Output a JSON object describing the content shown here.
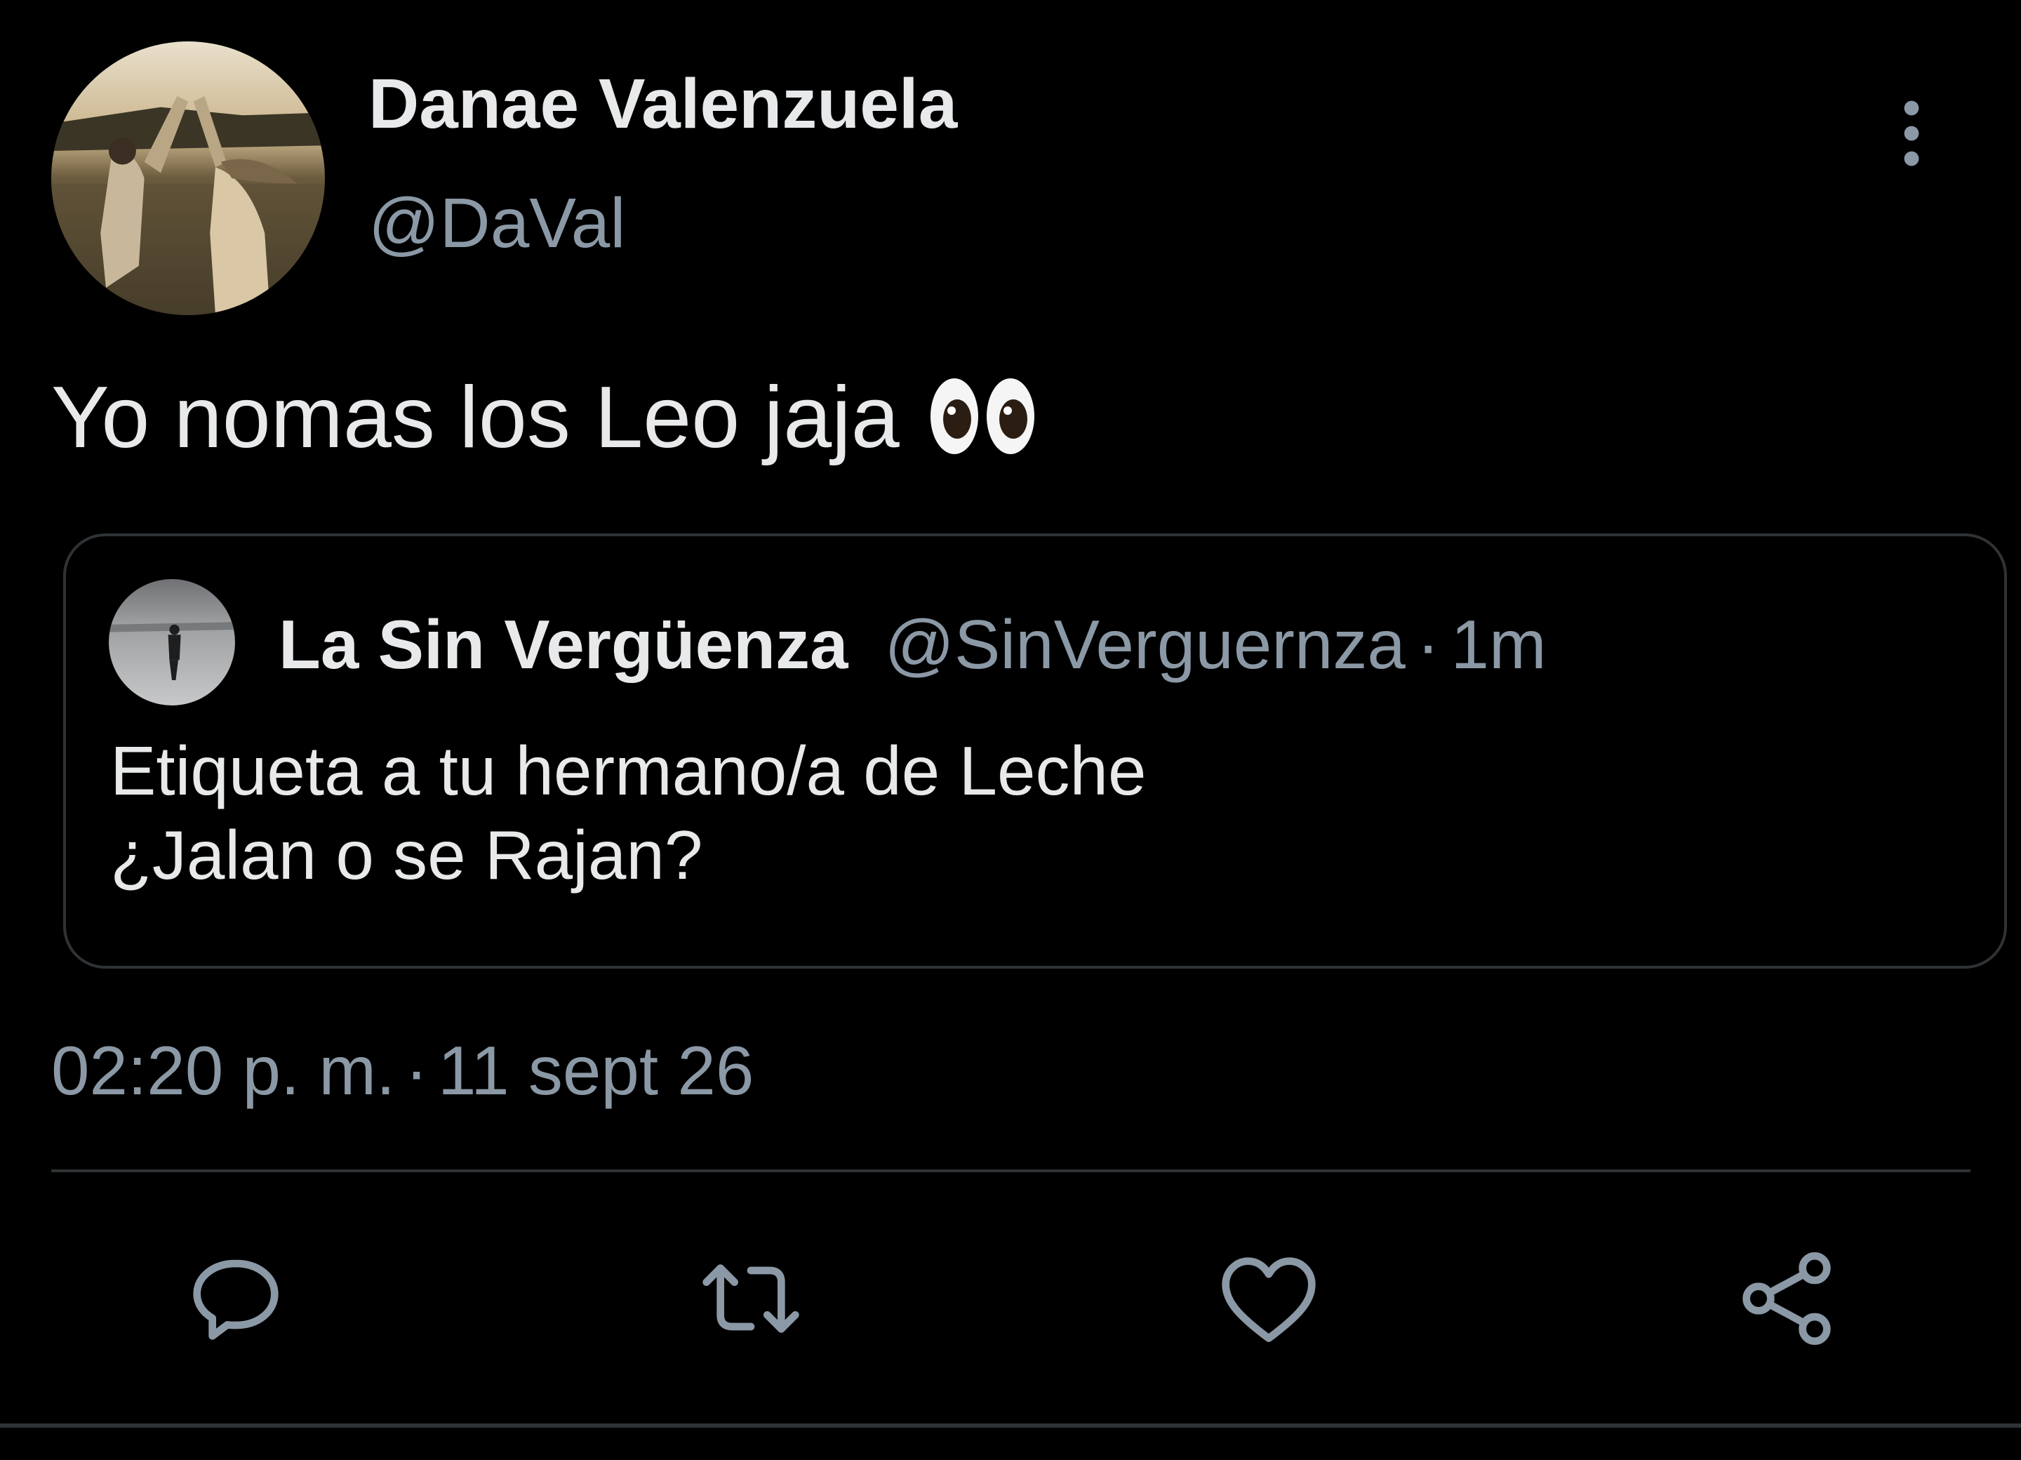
{
  "author": {
    "display_name": "Danae Valenzuela",
    "handle": "@DaVal",
    "avatar": "photo-couple-dancing-by-water"
  },
  "tweet": {
    "text": "Yo nomas los Leo jaja",
    "emoji": "eyes-emoji",
    "timestamp_time": "02:20 p. m.",
    "timestamp_separator": "·",
    "timestamp_date": "11 sept 26"
  },
  "quoted_tweet": {
    "display_name": "La Sin Vergüenza",
    "handle": "@SinVerguernza",
    "separator": "·",
    "time_ago": "1m",
    "avatar": "photo-person-in-snow",
    "line1": "Etiqueta a tu hermano/a de Leche",
    "line2": "¿Jalan o se Rajan?"
  },
  "actions": [
    {
      "name": "reply",
      "icon": "reply-bubble-icon"
    },
    {
      "name": "retweet",
      "icon": "retweet-icon"
    },
    {
      "name": "like",
      "icon": "heart-icon"
    },
    {
      "name": "share",
      "icon": "share-icon"
    }
  ],
  "menu_icon": "more-vertical-icon",
  "colors": {
    "background": "#000000",
    "primary_text": "#e7e9ea",
    "secondary_text": "#8b98a5",
    "border": "#2f3336"
  }
}
